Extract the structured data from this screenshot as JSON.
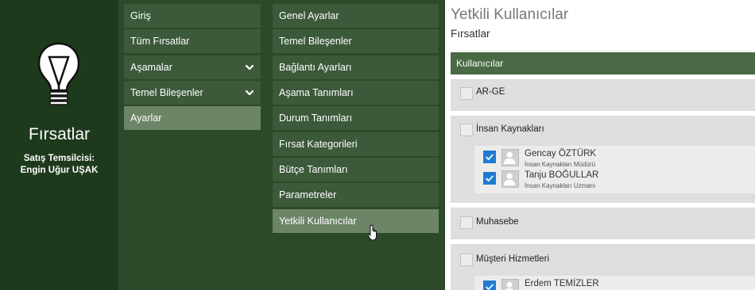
{
  "left_panel": {
    "app_title": "Fırsatlar",
    "role_label": "Satış Temsilcisi:",
    "user_name": "Engin Uğur UŞAK",
    "icon": "lightbulb-icon"
  },
  "nav_primary": [
    {
      "label": "Giriş"
    },
    {
      "label": "Tüm Fırsatlar"
    },
    {
      "label": "Aşamalar",
      "icon": "chevron-down-icon"
    },
    {
      "label": "Temel Bileşenler",
      "icon": "chevron-down-icon"
    },
    {
      "label": "Ayarlar",
      "selected": true
    }
  ],
  "nav_settings": [
    {
      "label": "Genel Ayarlar"
    },
    {
      "label": "Temel Bileşenler"
    },
    {
      "label": "Bağlantı Ayarları"
    },
    {
      "label": "Aşama Tanımları"
    },
    {
      "label": "Durum Tanımları"
    },
    {
      "label": "Fırsat Kategorileri"
    },
    {
      "label": "Bütçe Tanımları"
    },
    {
      "label": "Parametreler"
    },
    {
      "label": "Yetkili Kullanıcılar",
      "selected": true
    }
  ],
  "main": {
    "title": "Yetkili Kullanıcılar",
    "subtitle": "Fırsatlar",
    "group_header": "Kullanıcılar",
    "groups": [
      {
        "name": "AR-GE",
        "checked": false,
        "users": []
      },
      {
        "name": "İnsan Kaynakları",
        "checked": false,
        "users": [
          {
            "name": "Gencay ÖZTÜRK",
            "role": "İnsan Kaynakları Müdürü",
            "checked": true
          },
          {
            "name": "Tanju BOĞULLAR",
            "role": "İnsan Kaynakları Uzmanı",
            "checked": true
          }
        ]
      },
      {
        "name": "Muhasebe",
        "checked": false,
        "users": []
      },
      {
        "name": "Müşteri Hizmetleri",
        "checked": false,
        "users": [
          {
            "name": "Erdem TEMİZLER",
            "role": "",
            "checked": true
          }
        ]
      }
    ]
  },
  "colors": {
    "sidebar_dark": "#1e3a1c",
    "nav_bg": "#2c4a2a",
    "nav_item": "#3c593a",
    "nav_item_active": "#6b8566",
    "header_bar": "#4a6a45",
    "checkbox_checked": "#1f7bd1"
  }
}
